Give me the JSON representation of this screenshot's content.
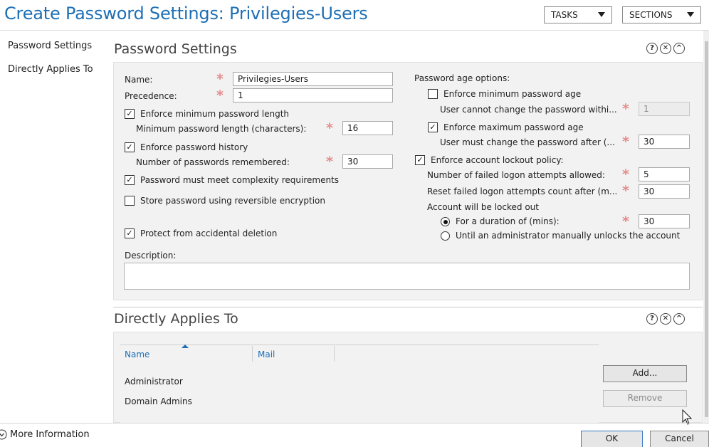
{
  "window": {
    "title": "Create Password Settings: Privilegies-Users",
    "tasks_label": "TASKS",
    "sections_label": "SECTIONS"
  },
  "nav": {
    "items": [
      {
        "label": "Password Settings"
      },
      {
        "label": "Directly Applies To"
      }
    ]
  },
  "password_settings": {
    "section_title": "Password Settings",
    "name_label": "Name:",
    "name_value": "Privilegies-Users",
    "precedence_label": "Precedence:",
    "precedence_value": "1",
    "enforce_min_length_label": "Enforce minimum password length",
    "enforce_min_length_checked": true,
    "min_length_label": "Minimum password length (characters):",
    "min_length_value": "16",
    "enforce_history_label": "Enforce password history",
    "enforce_history_checked": true,
    "history_label": "Number of passwords remembered:",
    "history_value": "30",
    "complexity_label": "Password must meet complexity requirements",
    "complexity_checked": true,
    "reversible_label": "Store password using reversible encryption",
    "reversible_checked": false,
    "protect_label": "Protect from accidental deletion",
    "protect_checked": true,
    "description_label": "Description:",
    "description_value": "",
    "age_options_label": "Password age options:",
    "enforce_min_age_label": "Enforce minimum password age",
    "enforce_min_age_checked": false,
    "min_age_label": "User cannot change the password withi...",
    "min_age_value": "1",
    "enforce_max_age_label": "Enforce maximum password age",
    "enforce_max_age_checked": true,
    "max_age_label": "User must change the password after (...",
    "max_age_value": "30",
    "lockout_label": "Enforce account lockout policy:",
    "lockout_checked": true,
    "failed_attempts_label": "Number of failed logon attempts allowed:",
    "failed_attempts_value": "5",
    "reset_count_label": "Reset failed logon attempts count after (m...",
    "reset_count_value": "30",
    "locked_out_label": "Account will be locked out",
    "duration_label": "For a duration of (mins):",
    "duration_selected": true,
    "duration_value": "30",
    "until_admin_label": "Until an administrator manually unlocks the account",
    "until_admin_selected": false
  },
  "applies_to": {
    "section_title": "Directly Applies To",
    "columns": [
      "Name",
      "Mail"
    ],
    "rows": [
      {
        "name": "Administrator",
        "mail": ""
      },
      {
        "name": "Domain Admins",
        "mail": ""
      }
    ],
    "add_label": "Add...",
    "remove_label": "Remove"
  },
  "footer": {
    "more_info_label": "More Information",
    "ok_label": "OK",
    "cancel_label": "Cancel"
  },
  "colors": {
    "title_blue": "#1e6fb5",
    "required_star": "#e78a8a",
    "panel_bg": "#f2f2f2"
  },
  "icons": [
    "help-icon",
    "close-icon",
    "collapse-icon",
    "sort-ascending-icon",
    "expand-circle-icon",
    "mouse-cursor-icon"
  ]
}
